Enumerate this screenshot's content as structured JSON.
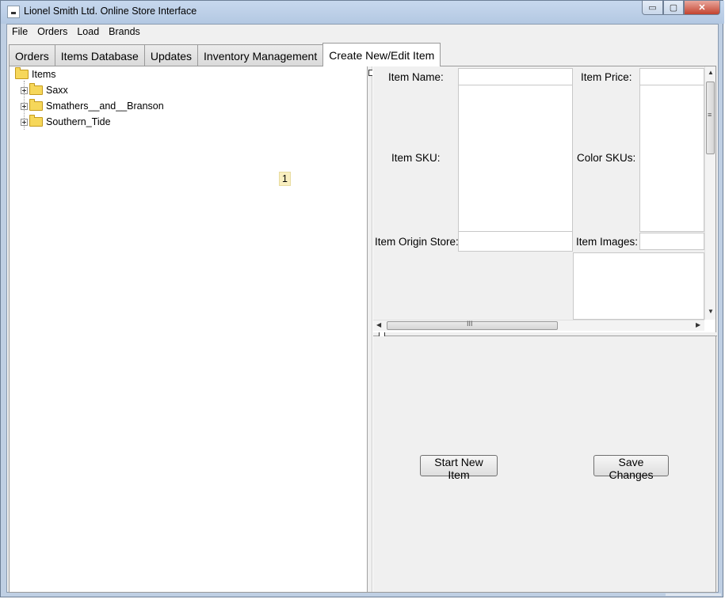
{
  "window": {
    "title": "Lionel Smith Ltd. Online Store Interface",
    "controls": {
      "minimize": "▭",
      "maximize": "▢",
      "close": "✕"
    }
  },
  "menu": {
    "items": [
      "File",
      "Orders",
      "Load",
      "Brands"
    ]
  },
  "tabs": [
    {
      "label": "Orders",
      "active": false
    },
    {
      "label": "Items Database",
      "active": false
    },
    {
      "label": "Updates",
      "active": false
    },
    {
      "label": "Inventory Management",
      "active": false
    },
    {
      "label": "Create New/Edit Item",
      "active": true
    }
  ],
  "tree": {
    "root": "Items",
    "children": [
      "Saxx",
      "Smathers__and__Branson",
      "Southern_Tide"
    ]
  },
  "tooltip": "1",
  "form": {
    "item_name_label": "Item Name:",
    "item_price_label": "Item Price:",
    "item_sku_label": "Item SKU:",
    "color_skus_label": "Color SKUs:",
    "item_origin_store_label": "Item Origin Store:",
    "item_images_label": "Item Images:",
    "item_name_value": "",
    "item_price_value": "",
    "item_sku_value": "",
    "color_skus_value": "",
    "item_origin_store_value": "",
    "item_images_value": ""
  },
  "scroll": {
    "h_thumb_glyph": "III",
    "v_thumb_glyph": "≡"
  },
  "buttons": {
    "start_new_item": "Start New Item",
    "save_changes": "Save Changes"
  },
  "colors": {
    "title_bar": "#bfcfe3",
    "close_button": "#c3432f",
    "panel_bg": "#f0f0f0",
    "tooltip_bg": "#f9efc0"
  }
}
